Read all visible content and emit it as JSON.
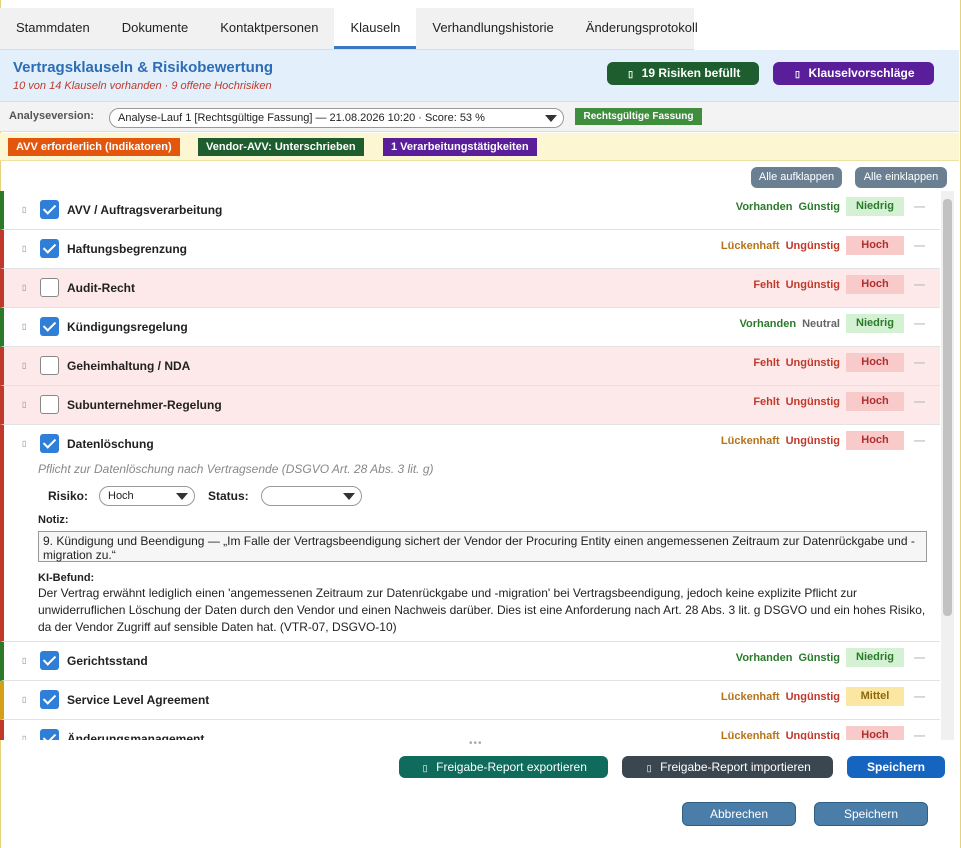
{
  "tabs": [
    "Stammdaten",
    "Dokumente",
    "Kontaktpersonen",
    "Klauseln",
    "Verhandlungshistorie",
    "Änderungsprotokoll"
  ],
  "header": {
    "title": "Vertragsklauseln & Risikobewertung",
    "subtitle": "10 von 14 Klauseln vorhanden  ·  9 offene Hochrisiken",
    "risks_button": "19 Risiken befüllt",
    "suggestions_button": "Klauselvorschläge"
  },
  "analysis": {
    "label": "Analyseversion:",
    "selected": "Analyse-Lauf 1 [Rechtsgültige Fassung]  —  21.08.2026 10:20  ·  Score: 53 %",
    "badge": "Rechtsgültige Fassung"
  },
  "indicators": [
    {
      "text": "AVV erforderlich (Indikatoren)",
      "color": "#e2560d"
    },
    {
      "text": "Vendor-AVV: Unterschrieben",
      "color": "#1e5e2e"
    },
    {
      "text": "1 Verarbeitungstätigkeiten",
      "color": "#5a1e9a"
    }
  ],
  "controls": {
    "expand_all": "Alle aufklappen",
    "collapse_all": "Alle einklappen"
  },
  "clauses": [
    {
      "title": "AVV / Auftragsverarbeitung",
      "checked": true,
      "status": "Vorhanden",
      "assessment": "Günstig",
      "risk": "Niedrig",
      "red": false
    },
    {
      "title": "Haftungsbegrenzung",
      "checked": true,
      "status": "Lückenhaft",
      "assessment": "Ungünstig",
      "risk": "Hoch",
      "red": false
    },
    {
      "title": "Audit-Recht",
      "checked": false,
      "status": "Fehlt",
      "assessment": "Ungünstig",
      "risk": "Hoch",
      "red": true
    },
    {
      "title": "Kündigungsregelung",
      "checked": true,
      "status": "Vorhanden",
      "assessment": "Neutral",
      "risk": "Niedrig",
      "red": false
    },
    {
      "title": "Geheimhaltung / NDA",
      "checked": false,
      "status": "Fehlt",
      "assessment": "Ungünstig",
      "risk": "Hoch",
      "red": true
    },
    {
      "title": "Subunternehmer-Regelung",
      "checked": false,
      "status": "Fehlt",
      "assessment": "Ungünstig",
      "risk": "Hoch",
      "red": true
    }
  ],
  "expanded": {
    "title": "Datenlöschung",
    "checked": true,
    "status": "Lückenhaft",
    "assessment": "Ungünstig",
    "risk": "Hoch",
    "description": "Pflicht zur Datenlöschung nach Vertragsende (DSGVO Art. 28 Abs. 3 lit. g)",
    "risk_label": "Risiko:",
    "risk_value": "Hoch",
    "status_label": "Status:",
    "status_value": "",
    "note_label": "Notiz:",
    "note": "9. Kündigung und Beendigung — „Im Falle der Vertragsbeendigung sichert der Vendor der Procuring Entity einen angemessenen Zeitraum zur Datenrückgabe und -migration zu.“",
    "ki_label": "KI-Befund:",
    "ki_text": "Der Vertrag erwähnt lediglich einen 'angemessenen Zeitraum zur Datenrückgabe und -migration' bei Vertragsbeendigung, jedoch keine explizite Pflicht zur unwiderruflichen Löschung der Daten durch den Vendor und einen Nachweis darüber. Dies ist eine Anforderung nach Art. 28 Abs. 3 lit. g DSGVO und ein hohes Risiko, da der Vendor Zugriff auf sensible Daten hat. (VTR-07, DSGVO-10)"
  },
  "clauses_after": [
    {
      "title": "Gerichtsstand",
      "checked": true,
      "status": "Vorhanden",
      "assessment": "Günstig",
      "risk": "Niedrig",
      "border": "#2a7a2a"
    },
    {
      "title": "Service Level Agreement",
      "checked": true,
      "status": "Lückenhaft",
      "assessment": "Ungünstig",
      "risk": "Mittel",
      "border": "#d4a017"
    },
    {
      "title": "Änderungsmanagement",
      "checked": true,
      "status": "Lückenhaft",
      "assessment": "Ungünstig",
      "risk": "Hoch",
      "border": "#c0392b"
    }
  ],
  "footer": {
    "export": "Freigabe-Report exportieren",
    "import": "Freigabe-Report importieren",
    "save_primary": "Speichern",
    "cancel": "Abbrechen",
    "save": "Speichern"
  }
}
